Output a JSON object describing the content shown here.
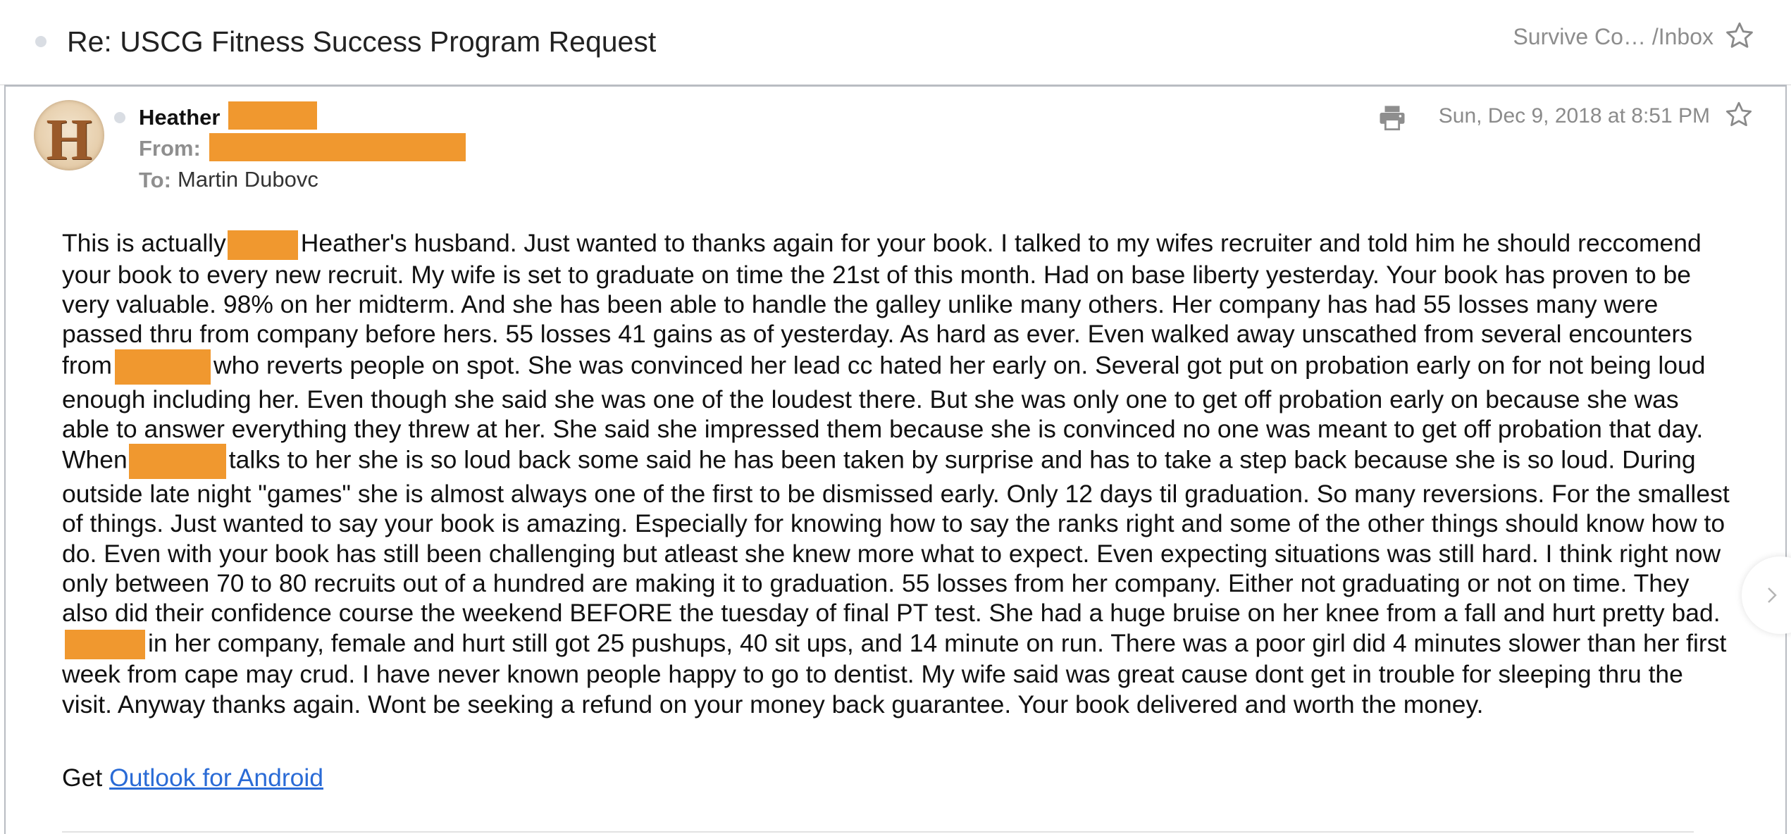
{
  "header": {
    "subject": "Re: USCG Fitness Success Program Request",
    "folder_path": "Survive Co… /Inbox"
  },
  "message": {
    "sender_name": "Heather",
    "from_label": "From:",
    "to_label": "To:",
    "to_value": "Martin Dubovc",
    "date": "Sun, Dec 9, 2018 at 8:51 PM",
    "avatar_letter": "H"
  },
  "body": {
    "p1": "This is actually",
    "p2": "Heather's husband. Just wanted to thanks again for your book. I talked to my wifes recruiter and told him he should reccomend your book to every new recruit. My wife is set to graduate on time the 21st of this month.  Had on base liberty yesterday. Your book has proven to be very valuable. 98% on her midterm. And she has been able to handle the galley unlike many others. Her company has had 55 losses many were passed thru from company before hers. 55 losses 41 gains as of yesterday.  As hard as ever. Even walked away unscathed from several encounters from",
    "p3": "who reverts people on spot. She was convinced her lead cc hated her early on. Several got put on probation early on for not being loud enough including her.  Even though she said she was one of the loudest there. But she was only one to get off probation early on because she was able to answer everything they threw at her. She said she impressed them because she is convinced no one was meant to get off probation that day. When",
    "p4": "talks to her she is so loud back some said he has been taken by surprise and has to take a step back because she is so loud. During outside late night \"games\" she is almost always one of the first to be dismissed early. Only 12 days til graduation.  So many reversions.  For the smallest of things. Just wanted to say your book is amazing. Especially for knowing how to say the ranks right and some of the other things should know how to do. Even with your book has still been challenging but atleast she knew more what to expect.  Even expecting situations was still hard. I think right now only between 70 to 80 recruits out of a hundred are making it to graduation.  55 losses from her company. Either not graduating or not on time. They also did their confidence course the weekend BEFORE the tuesday of final PT test. She had a huge bruise on her knee from a fall and hurt pretty bad.",
    "p5": "in her company, female and hurt still got 25 pushups, 40 sit ups, and 14 minute on run. There was a poor girl did 4 minutes slower than her first week from cape may crud. I have never known people happy to go to dentist. My wife said was great cause dont get in trouble for sleeping thru the visit.  Anyway thanks again. Wont be seeking a refund on your money back guarantee.  Your book delivered and worth the money."
  },
  "signature": {
    "prefix": "Get",
    "link_text": "Outlook for Android"
  },
  "icons": {
    "header_star": "star-outline-icon",
    "print": "printer-icon",
    "message_star": "star-outline-icon",
    "next": "chevron-right-icon"
  },
  "colors": {
    "redaction": "#f0982f",
    "link": "#2a6bd6",
    "muted_text": "#8b8b8b"
  }
}
